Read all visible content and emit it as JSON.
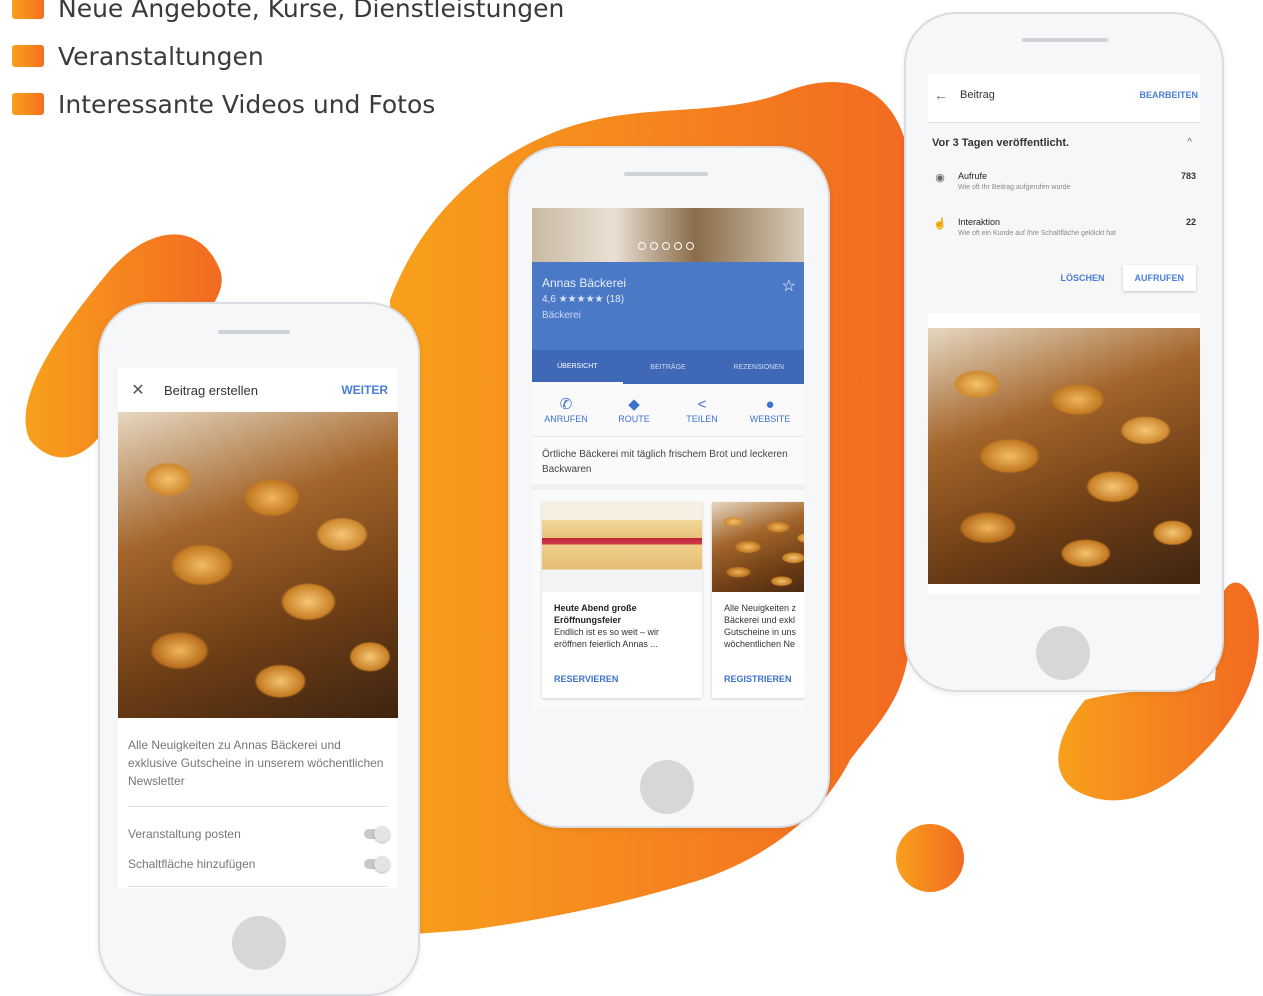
{
  "bullets": [
    "Neue Angebote, Kurse, Dienstleistungen",
    "Veranstaltungen",
    "Interessante Videos und Fotos"
  ],
  "colors": {
    "accent_start": "#f8a01c",
    "accent_end": "#f37021",
    "link_blue": "#4a7fd8",
    "header_blue": "#4c79c6"
  },
  "phone_create": {
    "close_icon": "close-icon",
    "title": "Beitrag erstellen",
    "next_label": "WEITER",
    "text": "Alle Neuigkeiten zu Annas Bäckerei und exklusive Gutscheine in unserem wöchentlichen Newsletter",
    "toggles": [
      {
        "label": "Veranstaltung posten",
        "state": "off"
      },
      {
        "label": "Schaltfläche hinzufügen",
        "state": "off"
      }
    ]
  },
  "phone_listing": {
    "business_name": "Annas Bäckerei",
    "rating": "4,6 ★★★★★ (18)",
    "category": "Bäckerei",
    "tabs": [
      "ÜBERSICHT",
      "BEITRÄGE",
      "REZENSIONEN"
    ],
    "active_tab": "ÜBERSICHT",
    "actions": [
      {
        "label": "ANRUFEN",
        "icon": "phone-icon"
      },
      {
        "label": "ROUTE",
        "icon": "directions-icon"
      },
      {
        "label": "TEILEN",
        "icon": "share-icon"
      },
      {
        "label": "WEBSITE",
        "icon": "globe-icon"
      }
    ],
    "description": "Örtliche Bäckerei mit täglich frischem Brot und leckeren Backwaren",
    "posts": [
      {
        "title": "Heute Abend große Eröffnungsfeier",
        "body": "Endlich ist es so weit – wir eröffnen feierlich Annas ...",
        "cta": "RESERVIEREN"
      },
      {
        "title": "",
        "body": "Alle Neuigkeiten z Bäckerei und exkl Gutscheine in uns wöchentlichen Ne",
        "cta": "REGISTRIEREN"
      }
    ]
  },
  "phone_post": {
    "title": "Beitrag",
    "edit_label": "BEARBEITEN",
    "published": "Vor 3 Tagen veröffentlicht.",
    "stats": [
      {
        "label": "Aufrufe",
        "desc": "Wie oft Ihr Beitrag aufgerufen wurde",
        "value": "783",
        "icon": "eye-icon"
      },
      {
        "label": "Interaktion",
        "desc": "Wie oft ein Kunde auf Ihre Schaltfläche geklickt hat",
        "value": "22",
        "icon": "touch-icon"
      }
    ],
    "delete_label": "LÖSCHEN",
    "open_label": "AUFRUFEN"
  }
}
